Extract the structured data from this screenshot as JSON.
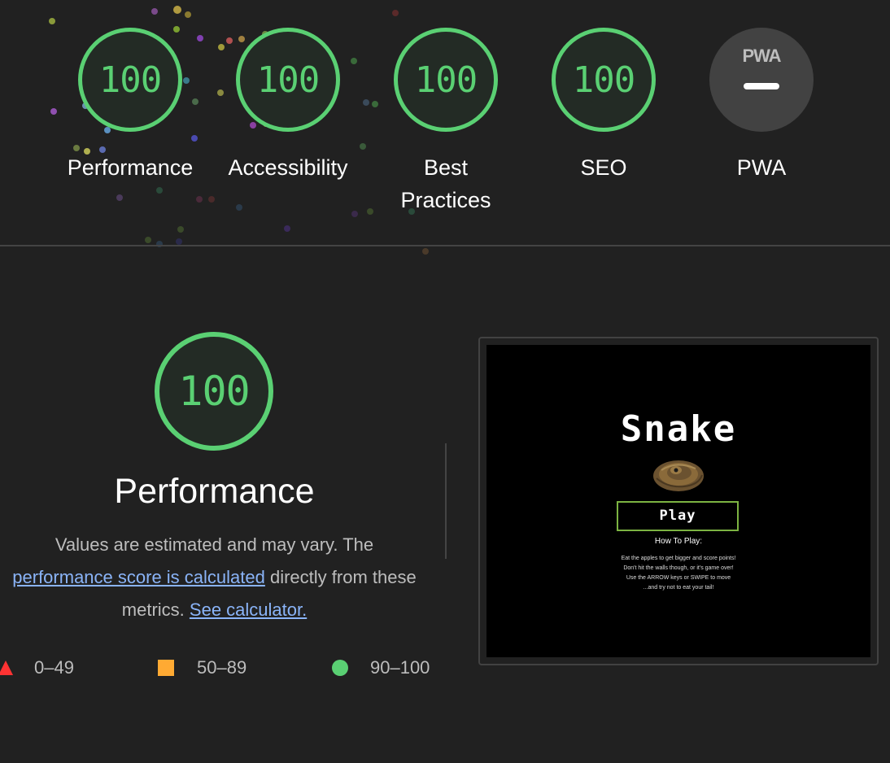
{
  "gauges": [
    {
      "score": "100",
      "label": "Performance"
    },
    {
      "score": "100",
      "label": "Accessibility"
    },
    {
      "score": "100",
      "label": "Best Practices"
    },
    {
      "score": "100",
      "label": "SEO"
    }
  ],
  "pwa": {
    "logo": "PWA",
    "label": "PWA"
  },
  "performance": {
    "score": "100",
    "title": "Performance",
    "desc_prefix": "Values are estimated and may vary. The",
    "desc_link": "performance score is calculated",
    "desc_middle": "directly from these metrics.",
    "calc_link": "See calculator."
  },
  "legend": [
    {
      "range": "0–49",
      "color": "#ff3333"
    },
    {
      "range": "50–89",
      "color": "#ffaa33"
    },
    {
      "range": "90–100",
      "color": "#5ad073"
    }
  ],
  "screenshot": {
    "title": "Snake",
    "play_label": "Play",
    "how_title": "How To Play:",
    "lines": [
      "Eat the apples to get bigger and score points!",
      "Don't hit the walls though, or it's game over!",
      "Use the ARROW keys or SWIPE to move",
      "...and try not to eat your tail!"
    ]
  },
  "colors": {
    "pass": "#5ad073",
    "average": "#ffaa33",
    "fail": "#ff3333",
    "link": "#8ab4f8"
  }
}
